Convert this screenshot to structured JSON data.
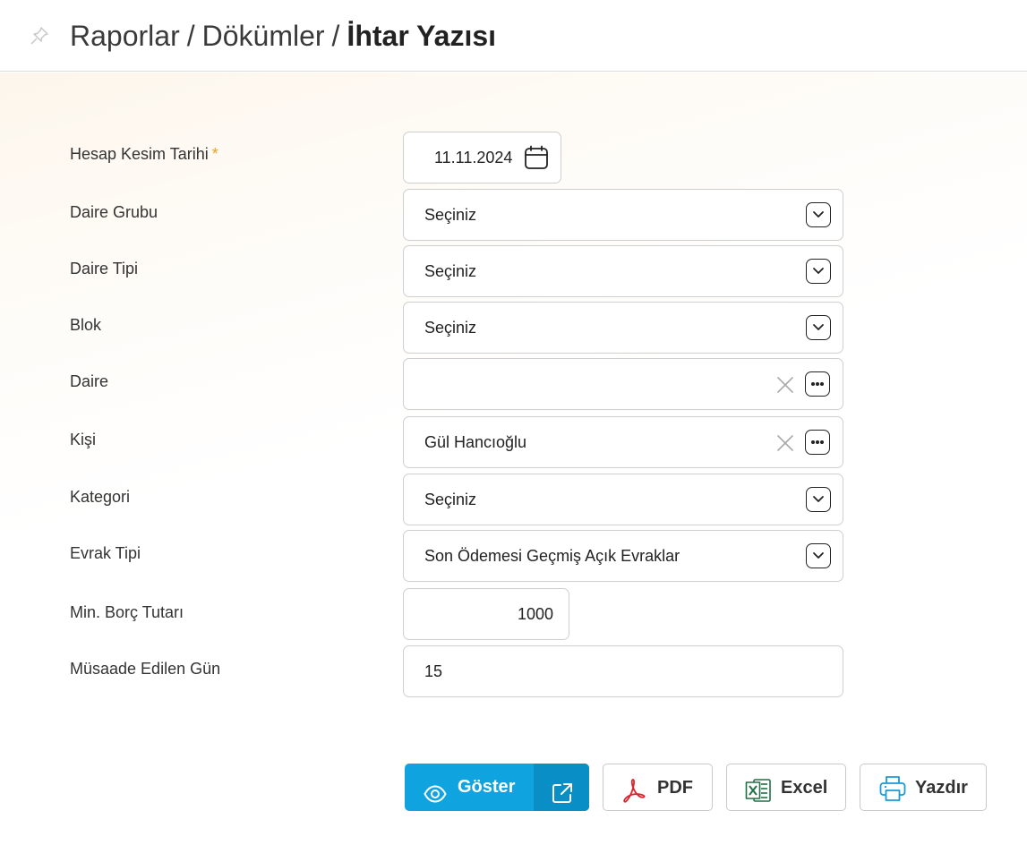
{
  "header": {
    "breadcrumb": [
      "Raporlar",
      "Dökümler",
      "İhtar Yazısı"
    ],
    "separator": "/",
    "pin_icon": "pin-icon"
  },
  "form": {
    "required_mark": "*",
    "fields": [
      {
        "label": "Hesap Kesim Tarihi",
        "value": "11.11.2024",
        "type": "date",
        "required": true
      },
      {
        "label": "Daire Grubu",
        "value": "Seçiniz",
        "type": "select"
      },
      {
        "label": "Daire Tipi",
        "value": "Seçiniz",
        "type": "select"
      },
      {
        "label": "Blok",
        "value": "Seçiniz",
        "type": "select"
      },
      {
        "label": "Daire",
        "value": "",
        "type": "lookup"
      },
      {
        "label": "Kişi",
        "value": "Gül Hancıoğlu",
        "type": "lookup"
      },
      {
        "label": "Kategori",
        "value": "Seçiniz",
        "type": "select"
      },
      {
        "label": "Evrak Tipi",
        "value": "Son Ödemesi Geçmiş Açık Evraklar",
        "type": "select"
      },
      {
        "label": "Min. Borç Tutarı",
        "value": "1000",
        "type": "number"
      },
      {
        "label": "Müsaade Edilen Gün",
        "value": "15",
        "type": "text"
      }
    ]
  },
  "actions": {
    "show": "Göster",
    "pdf": "PDF",
    "excel": "Excel",
    "print": "Yazdır"
  },
  "colors": {
    "primary": "#0fa3e0",
    "primary_dark": "#0a8ec6",
    "pdf_red": "#d7262e",
    "excel_green": "#1e7145",
    "print_blue": "#1a9ad6",
    "required": "#e8a317"
  }
}
